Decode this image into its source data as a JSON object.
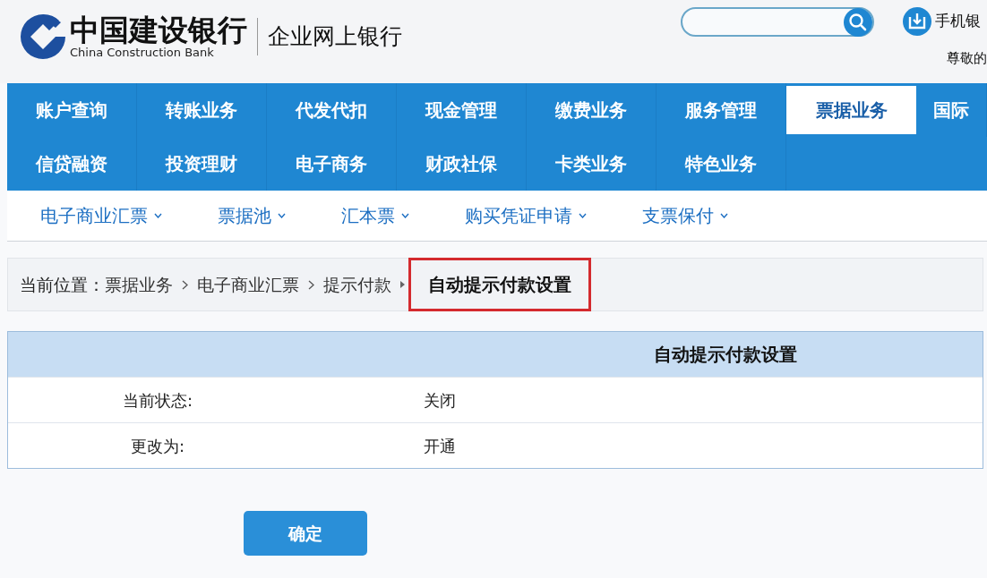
{
  "header": {
    "bank_name": "中国建设银行",
    "bank_name_en": "China Construction Bank",
    "product": "企业网上银行",
    "app_link": "手机银",
    "greeting": "尊敬的"
  },
  "main_nav": {
    "rows": [
      [
        {
          "label": "账户查询",
          "selected": false
        },
        {
          "label": "转账业务",
          "selected": false
        },
        {
          "label": "代发代扣",
          "selected": false
        },
        {
          "label": "现金管理",
          "selected": false
        },
        {
          "label": "缴费业务",
          "selected": false
        },
        {
          "label": "服务管理",
          "selected": false
        },
        {
          "label": "票据业务",
          "selected": true
        },
        {
          "label": "国际",
          "selected": false
        }
      ],
      [
        {
          "label": "信贷融资",
          "selected": false
        },
        {
          "label": "投资理财",
          "selected": false
        },
        {
          "label": "电子商务",
          "selected": false
        },
        {
          "label": "财政社保",
          "selected": false
        },
        {
          "label": "卡类业务",
          "selected": false
        },
        {
          "label": "特色业务",
          "selected": false
        }
      ]
    ]
  },
  "sub_nav": [
    {
      "label": "电子商业汇票",
      "has_dropdown": true
    },
    {
      "label": "票据池",
      "has_dropdown": true
    },
    {
      "label": "汇本票",
      "has_dropdown": true
    },
    {
      "label": "购买凭证申请",
      "has_dropdown": true
    },
    {
      "label": "支票保付",
      "has_dropdown": true
    }
  ],
  "breadcrumb": {
    "label": "当前位置：",
    "items": [
      {
        "text": "票据业务",
        "current": false,
        "highlighted": false
      },
      {
        "text": "电子商业汇票",
        "current": false,
        "highlighted": false
      },
      {
        "text": "提示付款",
        "current": false,
        "highlighted": false
      },
      {
        "text": "自动提示付款设置",
        "current": true,
        "highlighted": true
      }
    ]
  },
  "form": {
    "title": "自动提示付款设置",
    "rows": [
      {
        "label": "当前状态:",
        "value": "关闭"
      },
      {
        "label": "更改为:",
        "value": "开通"
      }
    ]
  },
  "buttons": [
    {
      "label": "确定"
    }
  ]
}
